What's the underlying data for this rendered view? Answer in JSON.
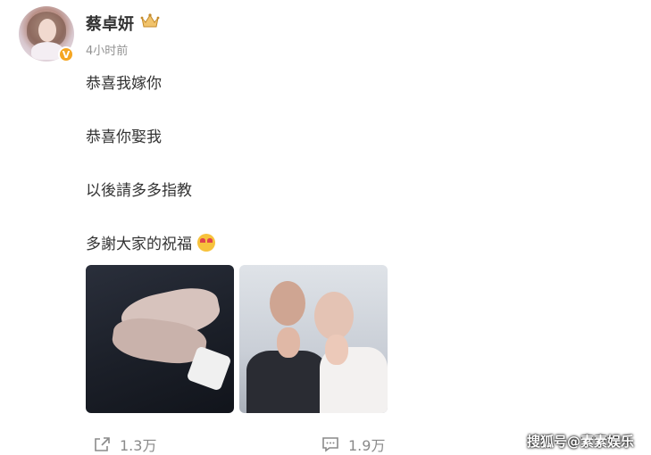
{
  "post": {
    "username": "蔡卓妍",
    "time": "4小时前",
    "lines": [
      "恭喜我嫁你",
      "恭喜你娶我",
      "以後請多多指教",
      "多謝大家的祝福"
    ]
  },
  "stats": {
    "repost_count": "1.3万",
    "comment_count": "1.9万"
  },
  "watermark": "搜狐号@素素娱乐",
  "colors": {
    "text": "#333333",
    "muted": "#939393",
    "badge": "#f5a623"
  }
}
